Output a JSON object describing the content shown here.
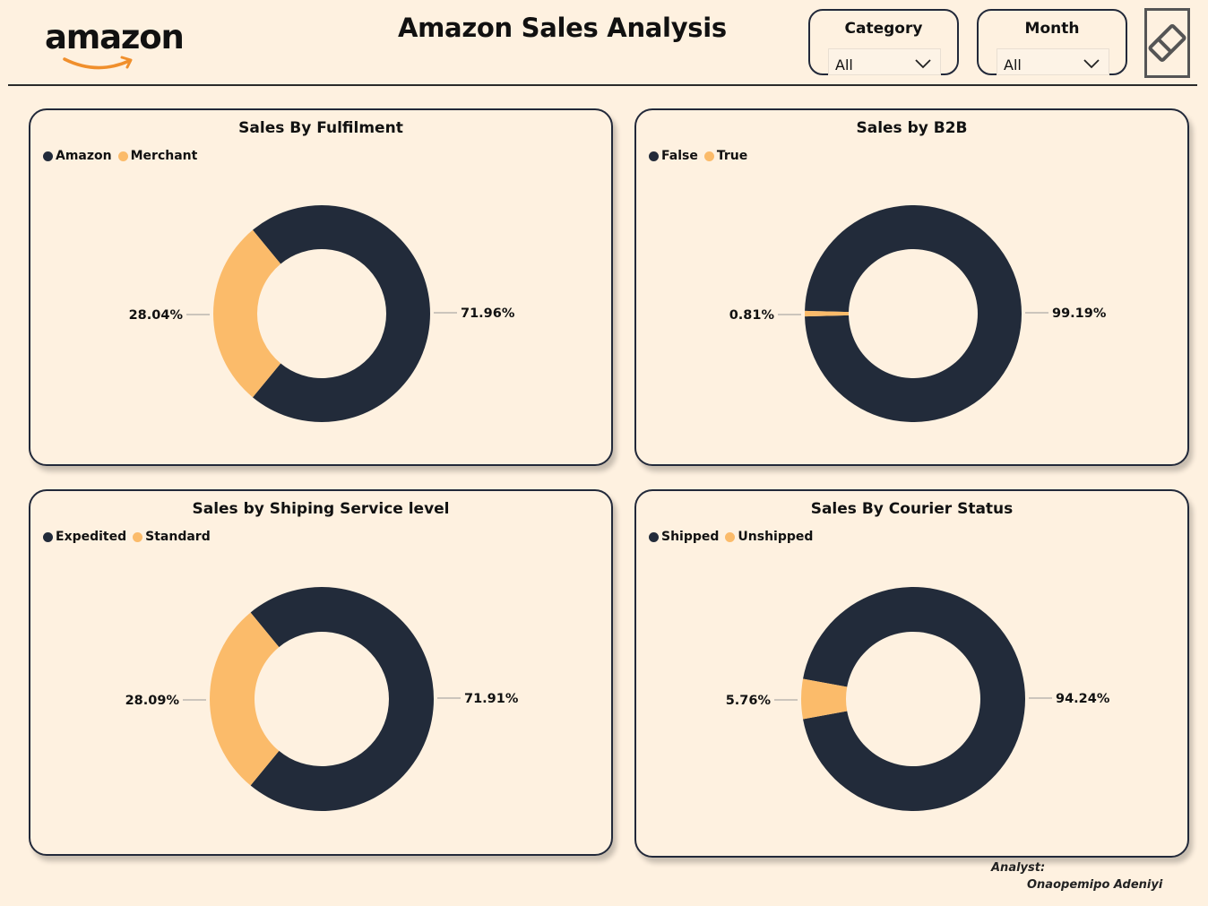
{
  "header": {
    "logo_text": "amazon",
    "title": "Amazon Sales Analysis"
  },
  "filters": [
    {
      "label": "Category",
      "value": "All"
    },
    {
      "label": "Month",
      "value": "All"
    }
  ],
  "icons": {
    "eraser": "eraser-icon",
    "chevron": "chevron-down-icon"
  },
  "colors": {
    "primary": "#222b3a",
    "secondary": "#fbbb6a",
    "background": "#fef1e0"
  },
  "chart_data": [
    {
      "type": "pie",
      "title": "Sales By Fulfilment",
      "categories": [
        "Amazon",
        "Merchant"
      ],
      "values": [
        71.96,
        28.04
      ],
      "labels": [
        "71.96%",
        "28.04%"
      ],
      "legend": "top-left",
      "donut": true
    },
    {
      "type": "pie",
      "title": "Sales by B2B",
      "categories": [
        "False",
        "True"
      ],
      "values": [
        99.19,
        0.81
      ],
      "labels": [
        "99.19%",
        "0.81%"
      ],
      "legend": "top-left",
      "donut": true
    },
    {
      "type": "pie",
      "title": "Sales by Shiping Service level",
      "categories": [
        "Expedited",
        "Standard"
      ],
      "values": [
        71.91,
        28.09
      ],
      "labels": [
        "71.91%",
        "28.09%"
      ],
      "legend": "top-left",
      "donut": true
    },
    {
      "type": "pie",
      "title": "Sales By Courier Status",
      "categories": [
        "Shipped",
        "Unshipped"
      ],
      "values": [
        94.24,
        5.76
      ],
      "labels": [
        "94.24%",
        "5.76%"
      ],
      "legend": "top-left",
      "donut": true
    }
  ],
  "footer": {
    "analyst_label": "Analyst:",
    "analyst_name": "Onaopemipo Adeniyi"
  }
}
